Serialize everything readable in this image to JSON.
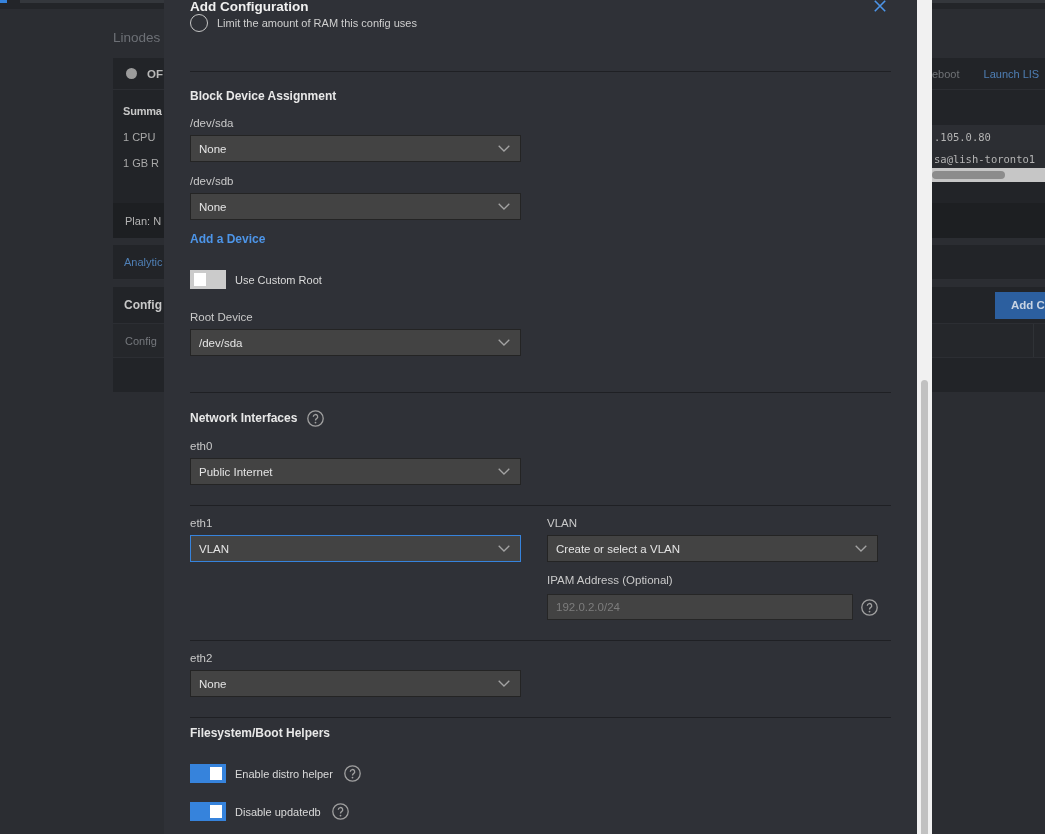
{
  "background": {
    "breadcrumb": "Linodes",
    "status": "OF",
    "summary_title": "Summa",
    "summary_lines": [
      "1 CPU",
      "1 GB R"
    ],
    "plan": "Plan: N",
    "analytics_tab": "Analytic",
    "configs_title": "Config",
    "configs_column": "Config",
    "actions": [
      "eboot",
      "Launch LIS"
    ],
    "ip_address": ".105.0.80",
    "lish_command": "sa@lish-toronto1",
    "add_button": "Add C"
  },
  "dialog": {
    "title": "Add Configuration",
    "memory_limit_option": {
      "label": "Limit the amount of RAM this config uses",
      "selected": false
    },
    "sections": [
      {
        "title": "Block Device Assignment",
        "items": [
          {
            "kind": "select",
            "label": "/dev/sda",
            "value": "None",
            "focused": false
          },
          {
            "kind": "select",
            "label": "/dev/sdb",
            "value": "None",
            "focused": false
          },
          {
            "kind": "link",
            "label": "Add a Device"
          },
          {
            "kind": "toggle",
            "label": "Use Custom Root",
            "on": false
          },
          {
            "kind": "select",
            "label": "Root Device",
            "value": "/dev/sda",
            "focused": false
          }
        ]
      },
      {
        "title": "Network Interfaces",
        "help": true,
        "items": [
          {
            "kind": "interface",
            "label": "eth0",
            "value": "Public Internet",
            "focused": false
          },
          {
            "kind": "interface",
            "label": "eth1",
            "value": "VLAN",
            "focused": true,
            "vlan": {
              "label": "VLAN",
              "value": "Create or select a VLAN"
            },
            "ipam": {
              "label": "IPAM Address (Optional)",
              "placeholder": "192.0.2.0/24",
              "help": true
            }
          },
          {
            "kind": "interface",
            "label": "eth2",
            "value": "None",
            "focused": false
          }
        ]
      },
      {
        "title": "Filesystem/Boot Helpers",
        "items": [
          {
            "kind": "toggle",
            "label": "Enable distro helper",
            "on": true,
            "help": true
          },
          {
            "kind": "toggle",
            "label": "Disable updatedb",
            "on": true,
            "help": true
          }
        ]
      }
    ]
  }
}
